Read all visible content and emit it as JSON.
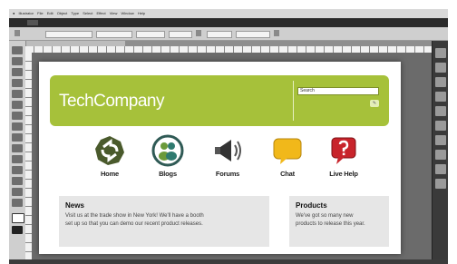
{
  "menubar": {
    "apple": "●",
    "items": [
      "Illustrator",
      "File",
      "Edit",
      "Object",
      "Type",
      "Select",
      "Effect",
      "View",
      "Window",
      "Help"
    ]
  },
  "site": {
    "logo": "TechCompany",
    "search": {
      "value": "Search"
    },
    "nav": [
      {
        "label": "Home",
        "icon": "recycle-arrows-icon",
        "color": "#4a5a2c"
      },
      {
        "label": "Blogs",
        "icon": "people-icon",
        "color": "#2f7a6f"
      },
      {
        "label": "Forums",
        "icon": "megaphone-icon",
        "color": "#333333"
      },
      {
        "label": "Chat",
        "icon": "speech-bubble-icon",
        "color": "#f1b81a"
      },
      {
        "label": "Live Help",
        "icon": "help-bubble-icon",
        "color": "#c8242b"
      }
    ],
    "news": {
      "title": "News",
      "body": [
        "Visit us at the trade show in New York! We'll have a booth",
        "set up so that you can demo our recent product releases."
      ]
    },
    "products": {
      "title": "Products",
      "body": [
        "We've got so many new",
        "products to release this year."
      ]
    }
  },
  "colors": {
    "header_green": "#a6c13a",
    "panel_gray": "#e6e6e6",
    "chrome_dark": "#3c3c3c"
  }
}
